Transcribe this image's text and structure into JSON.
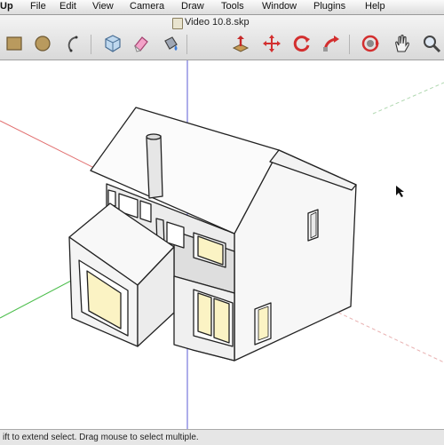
{
  "menubar": {
    "app_name": "Up",
    "items": [
      "File",
      "Edit",
      "View",
      "Camera",
      "Draw",
      "Tools",
      "Window",
      "Plugins",
      "Help"
    ]
  },
  "window": {
    "title": "Video 10.8.skp"
  },
  "toolbar": {
    "tools": [
      {
        "name": "rectangle-tool-icon"
      },
      {
        "name": "circle-tool-icon"
      },
      {
        "name": "arc-tool-icon"
      },
      {
        "name": "make-component-icon"
      },
      {
        "name": "eraser-tool-icon"
      },
      {
        "name": "paint-bucket-icon"
      },
      {
        "name": "push-pull-icon"
      },
      {
        "name": "move-tool-icon"
      },
      {
        "name": "rotate-tool-icon"
      },
      {
        "name": "follow-me-icon"
      },
      {
        "name": "orbit-tool-icon"
      },
      {
        "name": "pan-tool-icon"
      },
      {
        "name": "zoom-tool-icon"
      }
    ]
  },
  "status": {
    "text": "ift to extend select. Drag mouse to select multiple."
  },
  "colors": {
    "axis_red": "#e06a6a",
    "axis_green": "#4fbf4f",
    "axis_blue": "#5b5bd6",
    "window_glass": "#fbf3c4",
    "wall_light": "#f5f5f5",
    "wall_shade": "#e2e2e2"
  }
}
